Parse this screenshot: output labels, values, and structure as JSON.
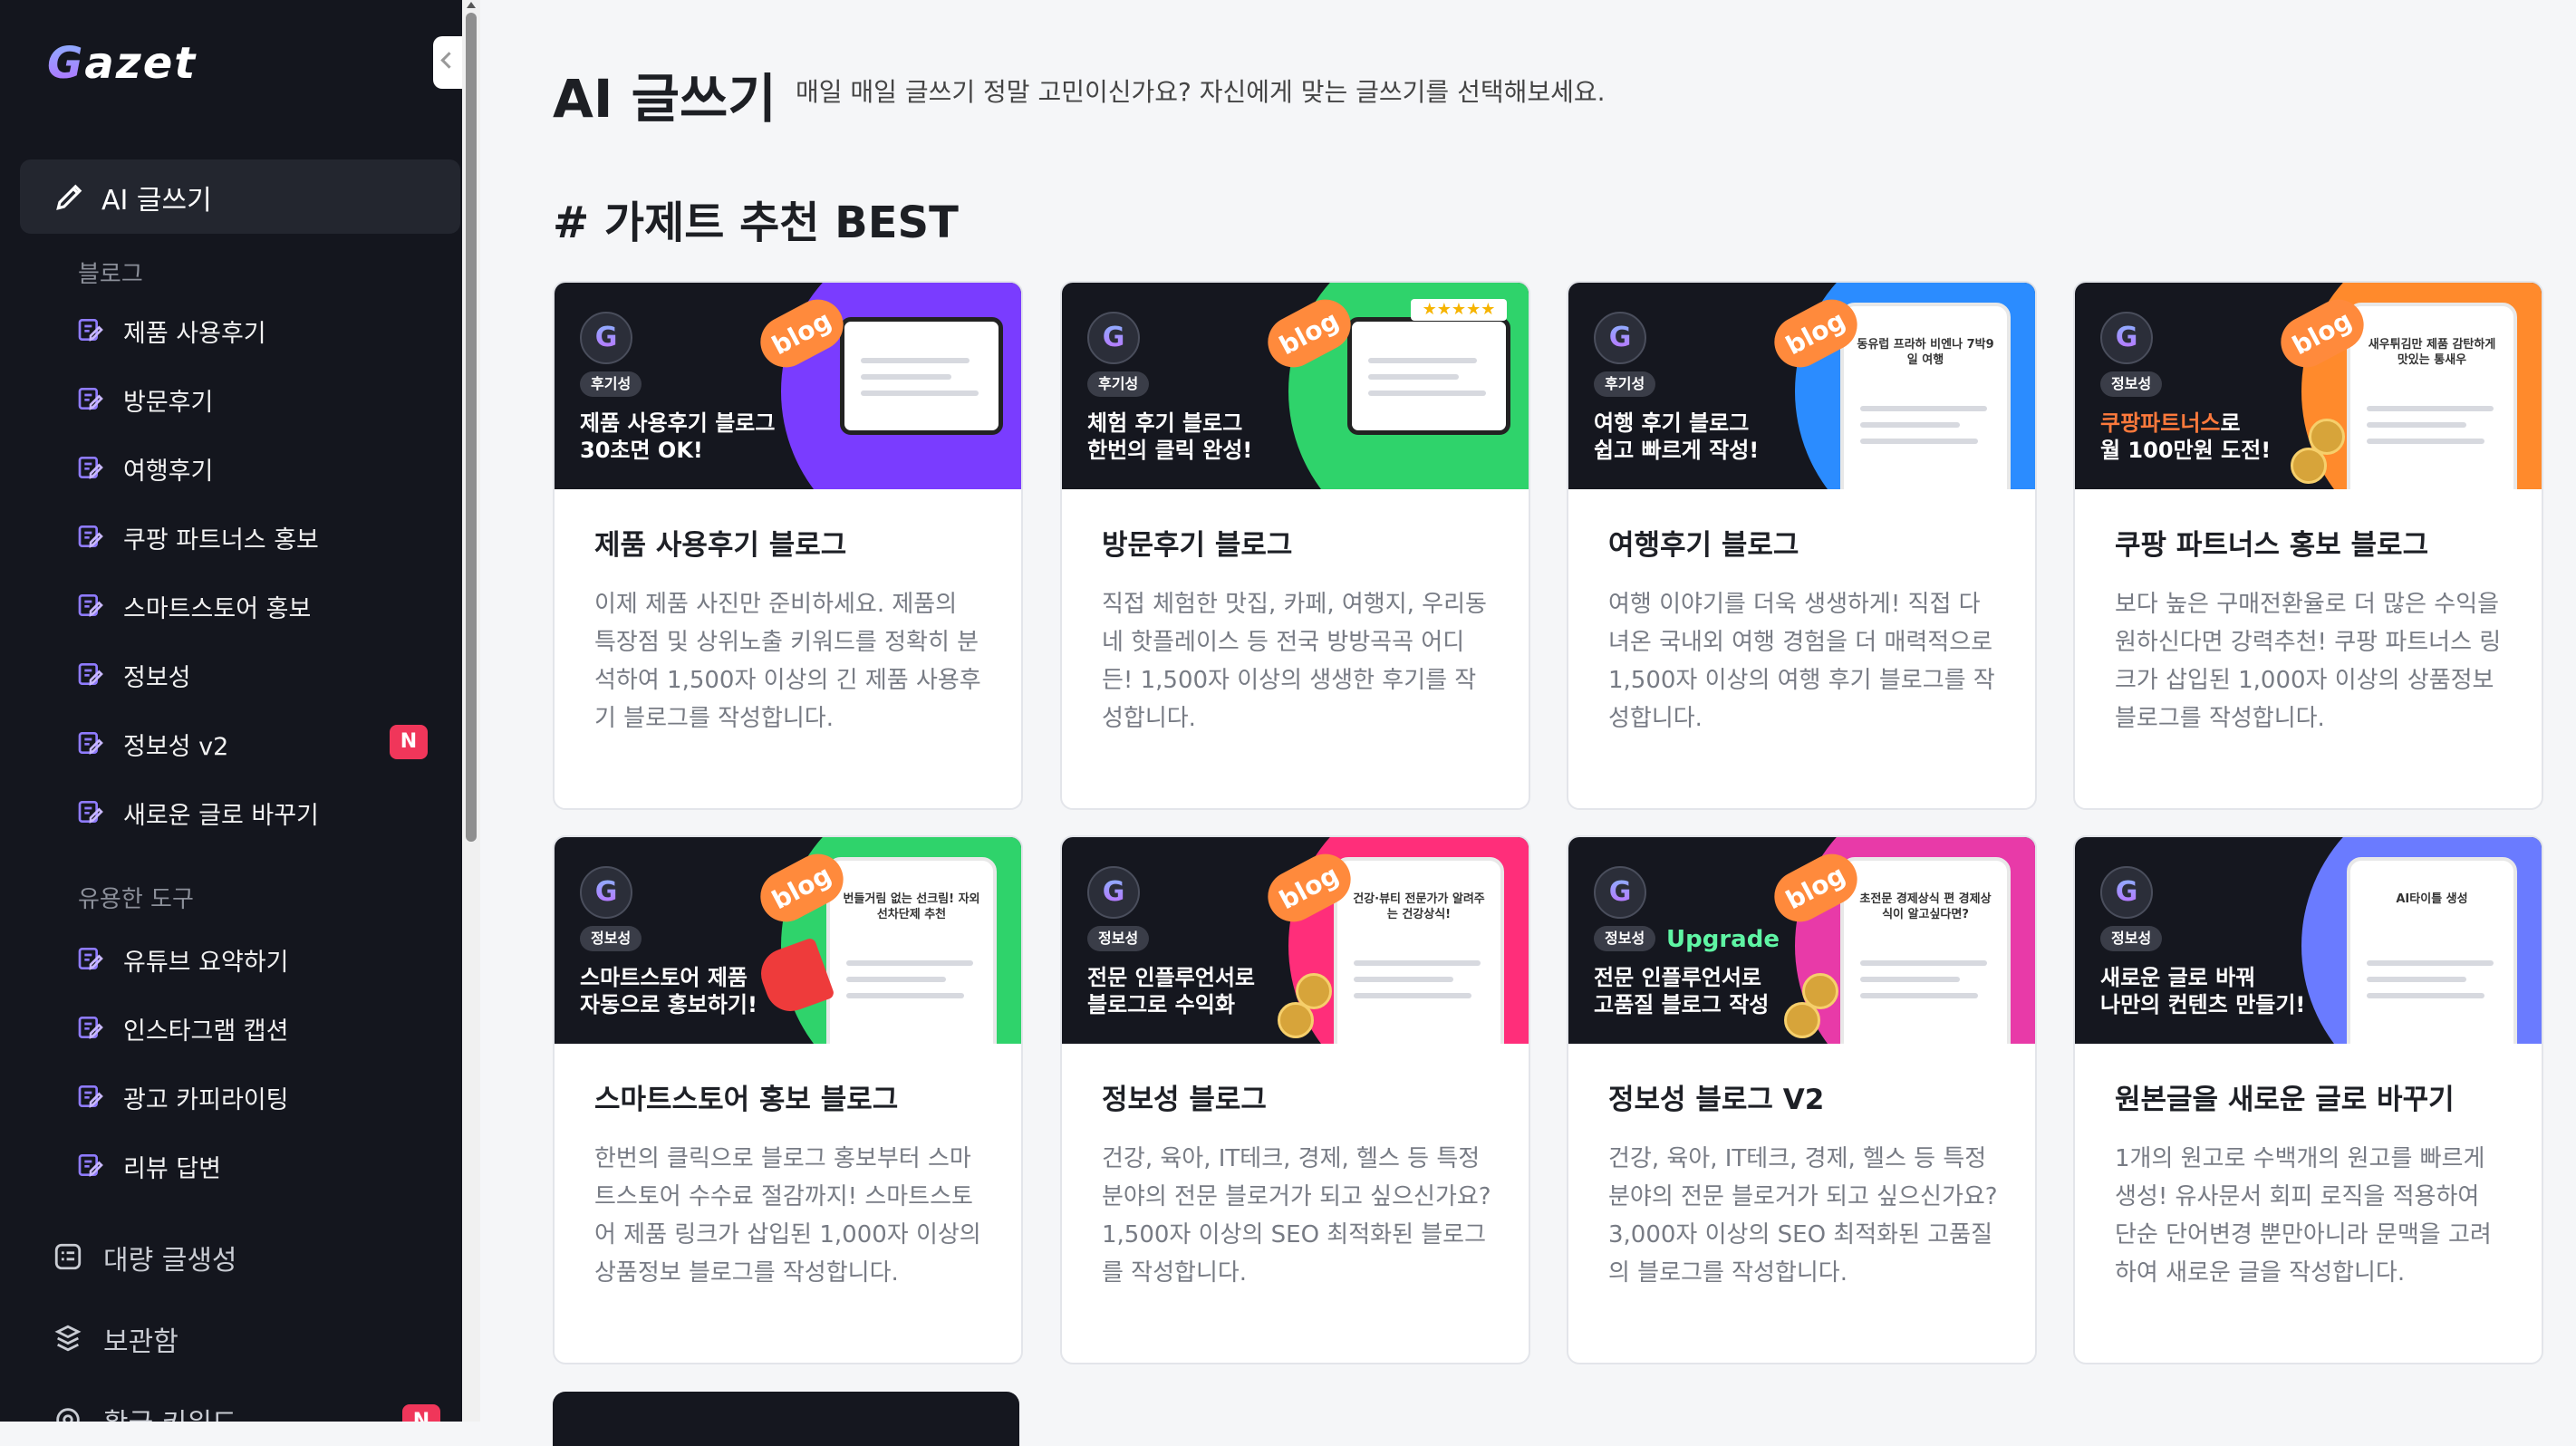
{
  "brand": {
    "logo_text": "Gazet"
  },
  "sidebar": {
    "active_item": {
      "label": "AI 글쓰기",
      "icon": "pencil-icon"
    },
    "blog_section": {
      "label": "블로그",
      "items": [
        {
          "label": "제품 사용후기",
          "icon": "edit-doc-icon"
        },
        {
          "label": "방문후기",
          "icon": "edit-doc-icon"
        },
        {
          "label": "여행후기",
          "icon": "edit-doc-icon"
        },
        {
          "label": "쿠팡 파트너스 홍보",
          "icon": "edit-doc-icon"
        },
        {
          "label": "스마트스토어 홍보",
          "icon": "edit-doc-icon"
        },
        {
          "label": "정보성",
          "icon": "edit-doc-icon"
        },
        {
          "label": "정보성 v2",
          "icon": "edit-doc-icon",
          "badge": "N"
        },
        {
          "label": "새로운 글로 바꾸기",
          "icon": "edit-doc-icon"
        }
      ]
    },
    "tools_section": {
      "label": "유용한 도구",
      "items": [
        {
          "label": "유튜브 요약하기",
          "icon": "edit-doc-icon"
        },
        {
          "label": "인스타그램 캡션",
          "icon": "edit-doc-icon"
        },
        {
          "label": "광고 카피라이팅",
          "icon": "edit-doc-icon"
        },
        {
          "label": "리뷰 답변",
          "icon": "edit-doc-icon"
        }
      ]
    },
    "main_items": [
      {
        "label": "대량 글생성",
        "icon": "list-icon"
      },
      {
        "label": "보관함",
        "icon": "archive-icon"
      },
      {
        "label": "황금 키워드",
        "icon": "target-icon",
        "badge": "N"
      }
    ]
  },
  "header": {
    "title": "AI 글쓰기",
    "subtitle": "매일 매일 글쓰기 정말 고민이신가요? 자신에게 맞는 글쓰기를 선택해보세요."
  },
  "section": {
    "title": "# 가제트 추천 BEST"
  },
  "cards": [
    {
      "tag": "후기성",
      "headline_1": "제품 사용후기 블로그",
      "headline_2": "30초면 OK!",
      "badge_text": "blog",
      "title": "제품 사용후기 블로그",
      "desc": "이제 제품 사진만 준비하세요. 제품의 특장점 및 상위노출 키워드를 정확히 분석하여 1,500자 이상의 긴 제품 사용후기 블로그를 작성합니다.",
      "accent": "#7a3cff"
    },
    {
      "tag": "후기성",
      "headline_1": "체험 후기 블로그",
      "headline_2": "한번의 클릭 완성!",
      "badge_text": "blog",
      "rating": "★★★★★",
      "title": "방문후기 블로그",
      "desc": "직접 체험한 맛집, 카페, 여행지, 우리동네 핫플레이스 등 전국 방방곡곡 어디든! 1,500자 이상의 생생한 후기를 작성합니다.",
      "accent": "#2fd36b"
    },
    {
      "tag": "후기성",
      "headline_1": "여행 후기 블로그",
      "headline_2": "쉽고 빠르게 작성!",
      "badge_text": "blog",
      "screen_text": "동유럽 프라하 비엔나 7박9일 여행",
      "title": "여행후기 블로그",
      "desc": "여행 이야기를 더욱 생생하게! 직접 다녀온 국내외 여행 경험을 더 매력적으로 1,500자 이상의 여행 후기 블로그를 작성합니다.",
      "accent": "#2b8cff"
    },
    {
      "tag": "정보성",
      "headline_hl": "쿠팡파트너스",
      "headline_1_rest": "로",
      "headline_2": "월 100만원 도전!",
      "badge_text": "blog",
      "screen_text": "새우튀김만 제품 감탄하게 맛있는 통새우",
      "title": "쿠팡 파트너스 홍보 블로그",
      "desc": "보다 높은 구매전환율로 더 많은 수익을 원하신다면 강력추천! 쿠팡 파트너스 링크가 삽입된 1,000자 이상의 상품정보 블로그를 작성합니다.",
      "accent": "#ff8a2c"
    },
    {
      "tag": "정보성",
      "headline_1": "스마트스토어 제품",
      "headline_2": "자동으로 홍보하기!",
      "badge_text": "blog",
      "screen_text": "번들거림 없는 선크림! 자외선차단제 추천",
      "title": "스마트스토어 홍보 블로그",
      "desc": "한번의 클릭으로 블로그 홍보부터 스마트스토어 수수료 절감까지! 스마트스토어 제품 링크가 삽입된 1,000자 이상의 상품정보 블로그를 작성합니다.",
      "accent": "#2fd36b"
    },
    {
      "tag": "정보성",
      "headline_1": "전문 인플루언서로",
      "headline_2": "블로그로 수익화",
      "badge_text": "blog",
      "screen_text": "건강·뷰티 전문가가 알려주는 건강상식!",
      "title": "정보성 블로그",
      "desc": "건강, 육아, IT테크, 경제, 헬스 등 특정 분야의 전문 블로거가 되고 싶으신가요? 1,500자 이상의 SEO 최적화된 블로그를 작성합니다.",
      "accent": "#ff2e7a"
    },
    {
      "tag": "정보성",
      "upgrade": "Upgrade",
      "headline_1": "전문 인플루언서로",
      "headline_2": "고품질 블로그 작성",
      "badge_text": "blog",
      "screen_text": "초전문 경제상식 편 경제상식이 알고싶다면?",
      "title": "정보성 블로그 V2",
      "desc": "건강, 육아, IT테크, 경제, 헬스 등 특정 분야의 전문 블로거가 되고 싶으신가요? 3,000자 이상의 SEO 최적화된 고품질의 블로그를 작성합니다.",
      "accent": "#e83aa8"
    },
    {
      "tag": "정보성",
      "headline_1": "새로운 글로 바꿔",
      "headline_2": "나만의 컨텐츠 만들기!",
      "screen_text": "AI타이틀 생성",
      "title": "원본글을 새로운 글로 바꾸기",
      "desc": "1개의 원고로 수백개의 원고를 빠르게 생성! 유사문서 회피 로직을 적용하여 단순 단어변경 뿐만아니라 문맥을 고려하여 새로운 글을 작성합니다.",
      "accent": "#6a7bff"
    }
  ]
}
